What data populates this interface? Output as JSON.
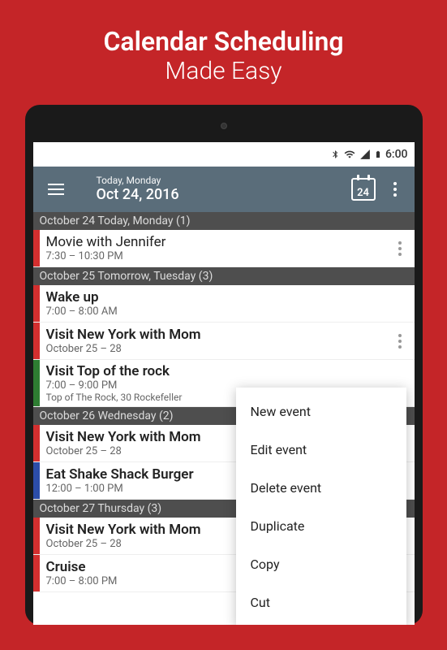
{
  "promo": {
    "line1": "Calendar Scheduling",
    "line2": "Made Easy"
  },
  "status_bar": {
    "time": "6:00"
  },
  "header": {
    "sub": "Today, Monday",
    "main": "Oct 24, 2016",
    "cal_day": "24"
  },
  "sections": [
    {
      "label": "October 24 Today, Monday (1)"
    },
    {
      "label": "October 25 Tomorrow, Tuesday (3)"
    },
    {
      "label": "October 26 Wednesday (2)"
    },
    {
      "label": "October 27 Thursday (3)"
    }
  ],
  "events": {
    "movie": {
      "title": "Movie with Jennifer",
      "time": "7:30 – 10:30 PM"
    },
    "wake": {
      "title": "Wake up",
      "time": "7:00 – 8:00 AM"
    },
    "ny1": {
      "title": "Visit New York with Mom",
      "time": "October 25 – 28"
    },
    "rock": {
      "title": "Visit Top of the rock",
      "time": "7:00 – 9:00 PM",
      "location": "Top of The Rock, 30 Rockefeller"
    },
    "ny2": {
      "title": "Visit New York with Mom",
      "time": "October 25 – 28"
    },
    "shake": {
      "title": "Eat Shake Shack Burger",
      "time": "12:00 – 1:00 PM"
    },
    "ny3": {
      "title": "Visit New York with Mom",
      "time": "October 25 – 28"
    },
    "cruise": {
      "title": "Cruise",
      "time": "7:00 – 8:00 PM"
    }
  },
  "menu": {
    "new": "New event",
    "edit": "Edit event",
    "delete": "Delete event",
    "duplicate": "Duplicate",
    "copy": "Copy",
    "cut": "Cut"
  }
}
